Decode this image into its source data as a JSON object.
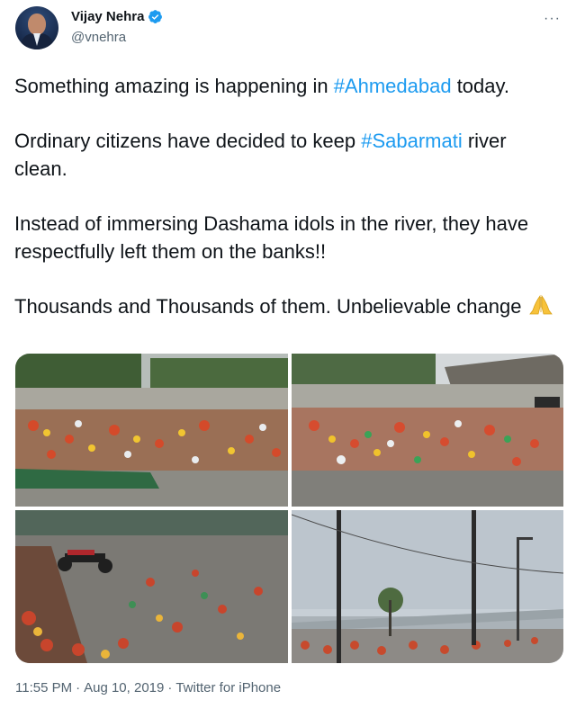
{
  "author": {
    "display_name": "Vijay Nehra",
    "handle": "@vnehra",
    "verified": true,
    "avatar": "profile-photo"
  },
  "more_menu": {
    "icon": "more-horizontal-icon",
    "label": "···"
  },
  "tweet": {
    "paragraphs": [
      [
        {
          "text": "Something amazing is happening in "
        },
        {
          "text": "#Ahmedabad",
          "hashtag": true
        },
        {
          "text": " today."
        }
      ],
      [
        {
          "text": "Ordinary citizens have decided to keep "
        },
        {
          "text": "#Sabarmati",
          "hashtag": true
        },
        {
          "text": " river clean."
        }
      ],
      [
        {
          "text": "Instead of immersing Dashama idols in the river, they have respectfully left them on the banks!!"
        }
      ],
      [
        {
          "text": "Thousands and Thousands of them. Unbelievable change "
        },
        {
          "emoji": "folded-hands-emoji"
        }
      ]
    ],
    "hashtag_color": "#1d9bf0"
  },
  "media": [
    {
      "name": "photo-1",
      "subject": "river bank littered with idols and debris, wall and trees behind"
    },
    {
      "name": "photo-2",
      "subject": "river bank with idols, flyover on the right"
    },
    {
      "name": "photo-3",
      "subject": "wet road with idols and a parked motorcycle"
    },
    {
      "name": "photo-4",
      "subject": "riverside road with street lights and bridge under grey sky"
    }
  ],
  "meta": {
    "time": "11:55 PM",
    "separator": "·",
    "date": "Aug 10, 2019",
    "source": "Twitter for iPhone"
  },
  "colors": {
    "text": "#0f1419",
    "secondary": "#536471",
    "accent": "#1d9bf0"
  }
}
